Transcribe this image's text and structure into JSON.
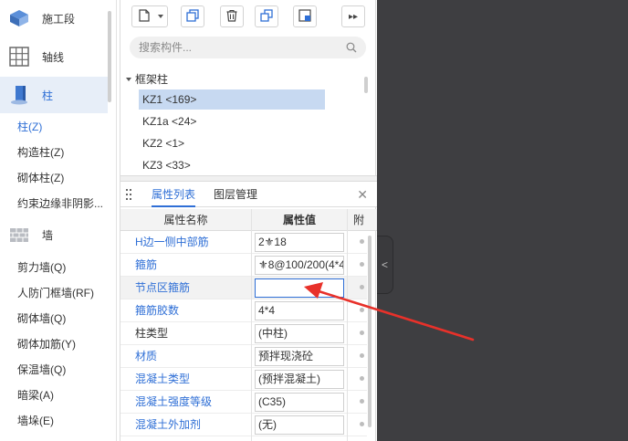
{
  "nav": {
    "categories": [
      {
        "label": "施工段",
        "icon": "stage-icon"
      },
      {
        "label": "轴线",
        "icon": "axis-grid-icon"
      },
      {
        "label": "柱",
        "icon": "column-icon"
      },
      {
        "label": "墙",
        "icon": "wall-icon"
      }
    ],
    "column_items": [
      "柱(Z)",
      "构造柱(Z)",
      "砌体柱(Z)",
      "约束边缘非阴影..."
    ],
    "wall_items": [
      "剪力墙(Q)",
      "人防门框墙(RF)",
      "砌体墙(Q)",
      "砌体加筋(Y)",
      "保温墙(Q)",
      "暗梁(A)",
      "墙垛(E)"
    ]
  },
  "search": {
    "placeholder": "搜索构件..."
  },
  "tree": {
    "root": "框架柱",
    "items": [
      "KZ1 <169>",
      "KZ1a <24>",
      "KZ2 <1>",
      "KZ3 <33>"
    ]
  },
  "props": {
    "tabs": [
      "属性列表",
      "图层管理"
    ],
    "headers": [
      "属性名称",
      "属性值",
      "附"
    ],
    "rows": [
      {
        "name": "H边一侧中部筋",
        "value": "2⚜18"
      },
      {
        "name": "箍筋",
        "value": "⚜8@100/200(4*4"
      },
      {
        "name": "节点区箍筋",
        "value": ""
      },
      {
        "name": "箍筋胶数",
        "value": "4*4"
      },
      {
        "name": "柱类型",
        "value": "(中柱)"
      },
      {
        "name": "材质",
        "value": "预拌现浇砼"
      },
      {
        "name": "混凝土类型",
        "value": "(预拌混凝土)"
      },
      {
        "name": "混凝土强度等级",
        "value": "(C35)"
      },
      {
        "name": "混凝土外加剂",
        "value": "(无)"
      }
    ]
  },
  "colors": {
    "accent": "#2f6fd6",
    "selection": "#c7d9f1",
    "viewport": "#3e3e41",
    "annotation_arrow": "#e8312a"
  }
}
